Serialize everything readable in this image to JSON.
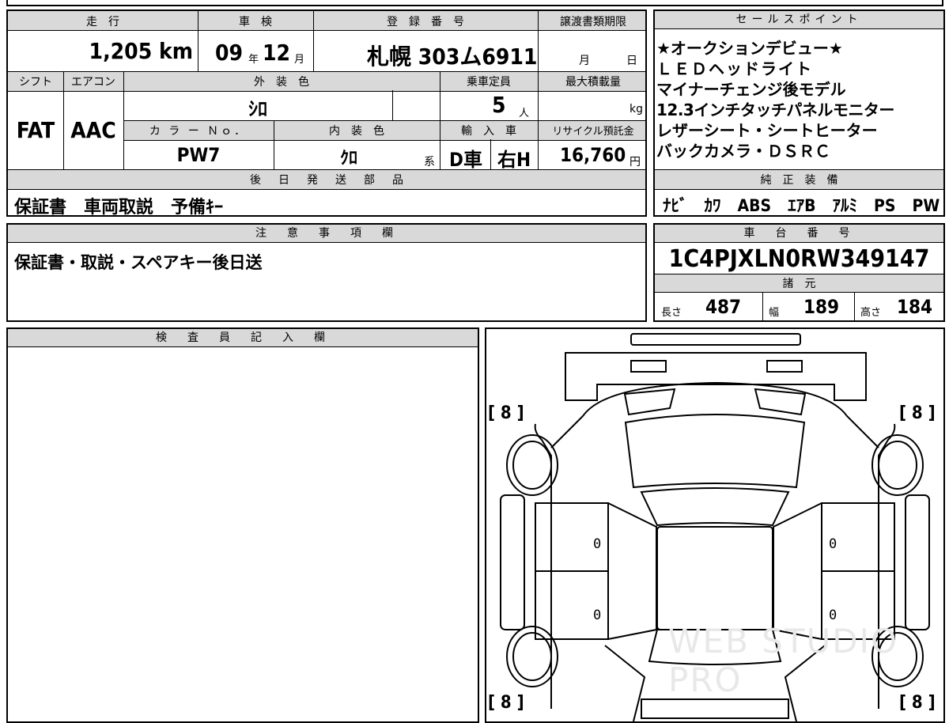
{
  "top_strip": "",
  "main": {
    "mileage_label": "走　行",
    "mileage": "1,205 km",
    "inspection_label": "車　検",
    "inspection_year": "09",
    "inspection_month": "12",
    "year_unit": "年",
    "month_unit": "月",
    "reg_label": "登　録　番　号",
    "reg_number": "札幌 303ム6911",
    "transfer_label": "譲渡書類期限",
    "transfer_month": "月",
    "transfer_day": "日",
    "shift_label": "シフト",
    "shift": "FAT",
    "ac_label": "エアコン",
    "ac": "AAC",
    "ext_color_label": "外　装　色",
    "ext_color": "ｼﾛ",
    "capacity_label": "乗車定員",
    "capacity": "5",
    "capacity_unit": "人",
    "maxload_label": "最大積載量",
    "maxload_unit": "kg",
    "color_no_label": "カ ラ ー Ｎｏ．",
    "color_no": "PW7",
    "int_color_label": "内　装　色",
    "int_color": "ｸﾛ",
    "int_color_suffix": "系",
    "import_label": "輸　入　車",
    "import_type": "D車",
    "handle": "右H",
    "recycle_label": "リサイクル預託金",
    "recycle": "16,760",
    "recycle_unit": "円",
    "later_label": "後　日　発　送　部　品",
    "later_items": "保証書　車両取説　予備ｷｰ"
  },
  "sales": {
    "title": "セールスポイント",
    "lines": [
      "★オークションデビュー★",
      "ＬＥＤヘッドライト",
      "マイナーチェンジ後モデル",
      "12.3インチタッチパネルモニター",
      "レザーシート・シートヒーター",
      "バックカメラ・ＤＳＲＣ"
    ]
  },
  "equipment": {
    "title": "純　正　装　備",
    "items": "ﾅﾋﾞ　ｶﾜ　ABS　ｴｱB　ｱﾙﾐ　PS　PW"
  },
  "notes": {
    "title": "注　意　事　項　欄",
    "text": "保証書・取説・スペアキー後日送"
  },
  "chassis": {
    "title": "車　台　番　号",
    "number": "1C4PJXLN0RW349147",
    "spec_title": "諸　元",
    "length_label": "長さ",
    "length": "487",
    "width_label": "幅",
    "width": "189",
    "height_label": "高さ",
    "height": "184"
  },
  "inspector": {
    "title": "検　査　員　記　入　欄"
  },
  "diagram": {
    "tread_fl": "[ 8 ]",
    "tread_fr": "[ 8 ]",
    "tread_rl": "[ 8 ]",
    "tread_rr": "[ 8 ]",
    "door_l1": "0",
    "door_l2": "0",
    "door_r1": "0",
    "door_r2": "0",
    "watermark": "WEB STUDIO PRO"
  }
}
